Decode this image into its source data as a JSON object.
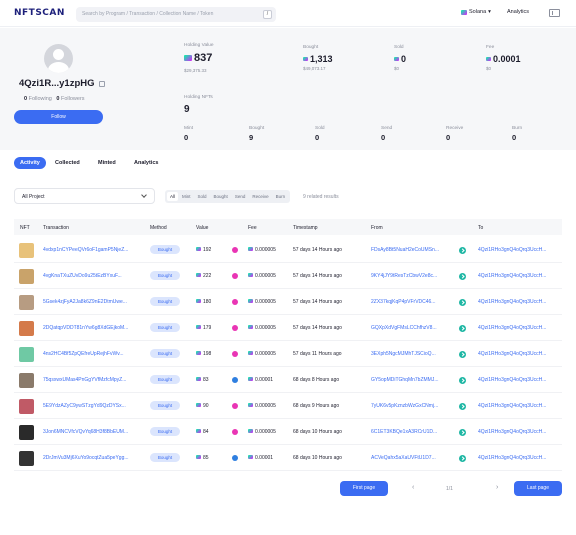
{
  "header": {
    "logo": "NFTSCAN",
    "search_placeholder": "Search by Program / Transaction / Collection Name / Token",
    "search_shortcut": "/",
    "chain": "Solana",
    "analytics": "Analytics"
  },
  "profile": {
    "address": "4Qzi1R...y1zpHG",
    "following_count": "0",
    "following_label": "Following",
    "followers_count": "0",
    "followers_label": "Followers",
    "follow_button": "Follow"
  },
  "stats": {
    "holding_value_label": "Holding Value",
    "holding_value": "837",
    "holding_value_usd": "$29,375.33",
    "bought_label": "Bought",
    "bought_value": "1,313",
    "bought_usd": "$49,073.17",
    "sold_label": "Sold",
    "sold_value": "0",
    "sold_usd": "$0",
    "fee_label": "Fee",
    "fee_value": "0.0001",
    "fee_usd": "$0",
    "holding_nfts_label": "Holding NFTs",
    "holding_nfts": "9",
    "mint_label": "Mint",
    "mint": "0",
    "bought_count_label": "Bought",
    "bought_count": "9",
    "sold_count_label": "Sold",
    "sold_count": "0",
    "send_label": "Send",
    "send": "0",
    "receive_label": "Receive",
    "receive": "0",
    "burn_label": "Burn",
    "burn": "0"
  },
  "tabs": [
    "Activity",
    "Collected",
    "Minted",
    "Analytics"
  ],
  "filters": {
    "project": "All Project",
    "chips": [
      "All",
      "Mint",
      "Sold",
      "Bought",
      "Send",
      "Receive",
      "Burn"
    ],
    "results": "9 related results"
  },
  "table": {
    "headers": [
      "NFT",
      "Transaction",
      "Method",
      "Value",
      "Fee",
      "Timestamp",
      "From",
      "To"
    ],
    "rows": [
      {
        "tx": "4vdxp1nCYPeeQVr6oF1gamP5NjeZ...",
        "method": "Bought",
        "value": "192",
        "fee": "0.000005",
        "time": "57 days 14 Hours ago",
        "from": "FDsAy8Bt5NuaH2eCoUMSn...",
        "to": "4Qzi1RHo3gnQ4oQrq3UccH...",
        "thumb": "#e8c27a",
        "mp": "#e935b4"
      },
      {
        "tx": "4vgKnaTXuZUvDo9u25tEzBYxuF...",
        "method": "Bought",
        "value": "222",
        "fee": "0.000005",
        "time": "57 days 14 Hours ago",
        "from": "9KY4jJY9tResTzCbwV2e8c...",
        "to": "4Qzi1RHo3gnQ4oQrq3UccH...",
        "thumb": "#c9a36a",
        "mp": "#e935b4"
      },
      {
        "tx": "5Gsek4zjFyA2Ja8k6Z9nE2DtmUwe...",
        "method": "Bought",
        "value": "180",
        "fee": "0.000005",
        "time": "57 days 14 Hours ago",
        "from": "2ZX37kqjKqP4pVFrVDC46...",
        "to": "4Qzi1RHo3gnQ4oQrq3UccH...",
        "thumb": "#b79c82",
        "mp": "#e935b4"
      },
      {
        "tx": "2DQatqpVDDT81nYw6g8XdGEjkoM...",
        "method": "Bought",
        "value": "179",
        "fee": "0.000005",
        "time": "57 days 14 Hours ago",
        "from": "GQXpXdVgFMsLCChfhzV8...",
        "to": "4Qzi1RHo3gnQ4oQrq3UccH...",
        "thumb": "#d47a4a",
        "mp": "#e935b4"
      },
      {
        "tx": "4ns2HC4Bf5ZpQEfreUpRejhFvWv...",
        "method": "Bought",
        "value": "198",
        "fee": "0.000005",
        "time": "57 days 11 Hours ago",
        "from": "3EXph5NgcMJMhTJSCioQ...",
        "to": "4Qzi1RHo3gnQ4oQrq3UccH...",
        "thumb": "#6fc9a4",
        "mp": "#e935b4"
      },
      {
        "tx": "75qsxwxUMas4PnGgYVfMzfcMpyZ...",
        "method": "Bought",
        "value": "83",
        "fee": "0.00001",
        "time": "68 days 8 Hours ago",
        "from": "GY5opMDiTGhqMn7bZMMJ...",
        "to": "4Qzi1RHo3gnQ4oQrq3UccH...",
        "thumb": "#8a7a6a",
        "mp": "#2f7fe0"
      },
      {
        "tx": "5E9YdzAZyC9ywSTzgYd9QzDYSx...",
        "method": "Bought",
        "value": "90",
        "fee": "0.000005",
        "time": "68 days 9 Hours ago",
        "from": "7yUK6v5pKznzbWzGxCNmj...",
        "to": "4Qzi1RHo3gnQ4oQrq3UccH...",
        "thumb": "#c05a66",
        "mp": "#e935b4"
      },
      {
        "tx": "3Jon6MNCVfcVQvYq68H3f8BbEUM...",
        "method": "Bought",
        "value": "84",
        "fee": "0.000005",
        "time": "68 days 10 Hours ago",
        "from": "6C1ET3KBQe1xA3RCrU1D...",
        "to": "4Qzi1RHo3gnQ4oQrq3UccH...",
        "thumb": "#2a2a2a",
        "mp": "#e935b4"
      },
      {
        "tx": "2DrJmVu3Mj6XuYo9ocqtZua5peYgg...",
        "method": "Bought",
        "value": "85",
        "fee": "0.00001",
        "time": "68 days 10 Hours ago",
        "from": "ACVeQahx5aXaUVFtU1D7...",
        "to": "4Qzi1RHo3gnQ4oQrq3UccH...",
        "thumb": "#333333",
        "mp": "#2f7fe0"
      }
    ]
  },
  "pagination": {
    "first": "First page",
    "prev": "‹",
    "info": "1/1",
    "next": "›",
    "last": "Last page"
  }
}
